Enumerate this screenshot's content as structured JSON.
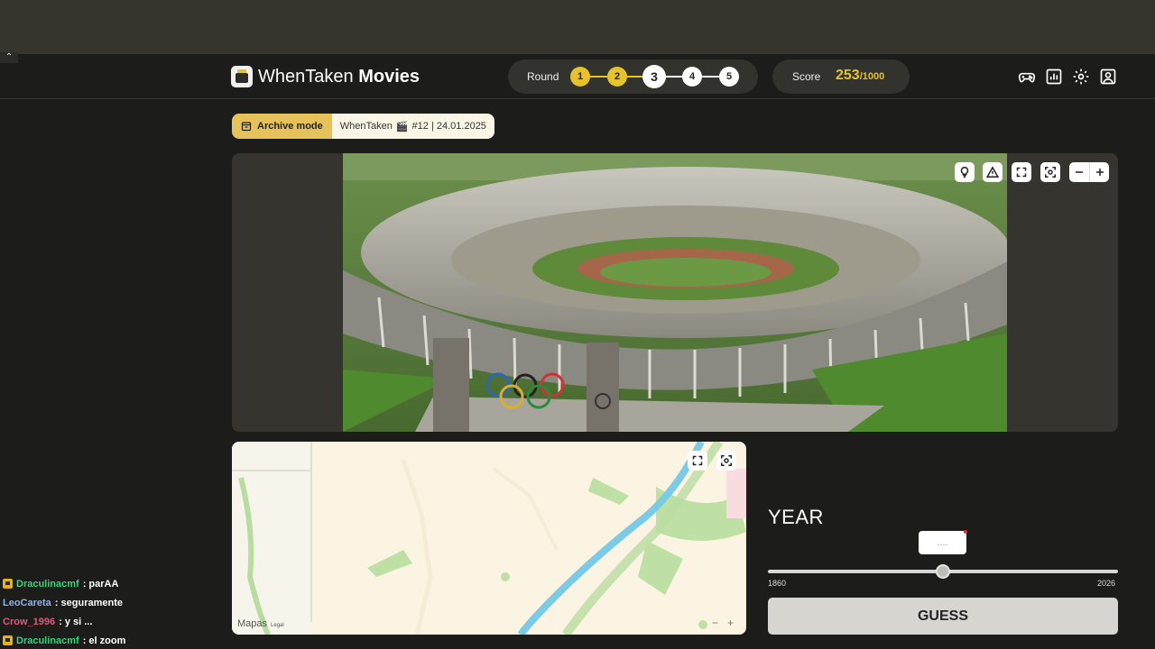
{
  "app": {
    "title_main": "WhenTaken",
    "title_sub": "Movies"
  },
  "round": {
    "label": "Round",
    "items": [
      "1",
      "2",
      "3",
      "4",
      "5"
    ],
    "current": 3,
    "accent_color": "#e6c22c"
  },
  "score": {
    "label": "Score",
    "value": "253",
    "max": "/1000"
  },
  "nav": {
    "icons": [
      "gamepad-icon",
      "stats-icon",
      "settings-icon",
      "profile-icon"
    ]
  },
  "badge": {
    "mode": "Archive mode",
    "info_name": "WhenTaken",
    "info_emoji": "🎬",
    "info_detail": "#12 | 24.01.2025"
  },
  "photo_tools": [
    "hint-icon",
    "warning-icon",
    "fullscreen-icon",
    "focus-icon",
    "zoom-out-icon",
    "zoom-in-icon"
  ],
  "map": {
    "attribution": "Mapas",
    "legal": "Legal",
    "zoom_out": "−",
    "zoom_in": "+"
  },
  "year": {
    "label": "YEAR",
    "placeholder": "....",
    "min": "1860",
    "max": "2026",
    "slider_fraction": 0.5,
    "guess_label": "GUESS"
  },
  "chat": [
    {
      "user": "Draculinacmf",
      "message": ": parAA",
      "color": "#33d67a",
      "badge": true
    },
    {
      "user": "LeoCareta",
      "message": ": seguramente",
      "color": "#8fb3e8",
      "badge": false
    },
    {
      "user": "Crow_1996",
      "message": ": y si ...",
      "color": "#e05a7a",
      "badge": false
    },
    {
      "user": "Draculinacmf",
      "message": ": el zoom",
      "color": "#33d67a",
      "badge": true
    }
  ]
}
